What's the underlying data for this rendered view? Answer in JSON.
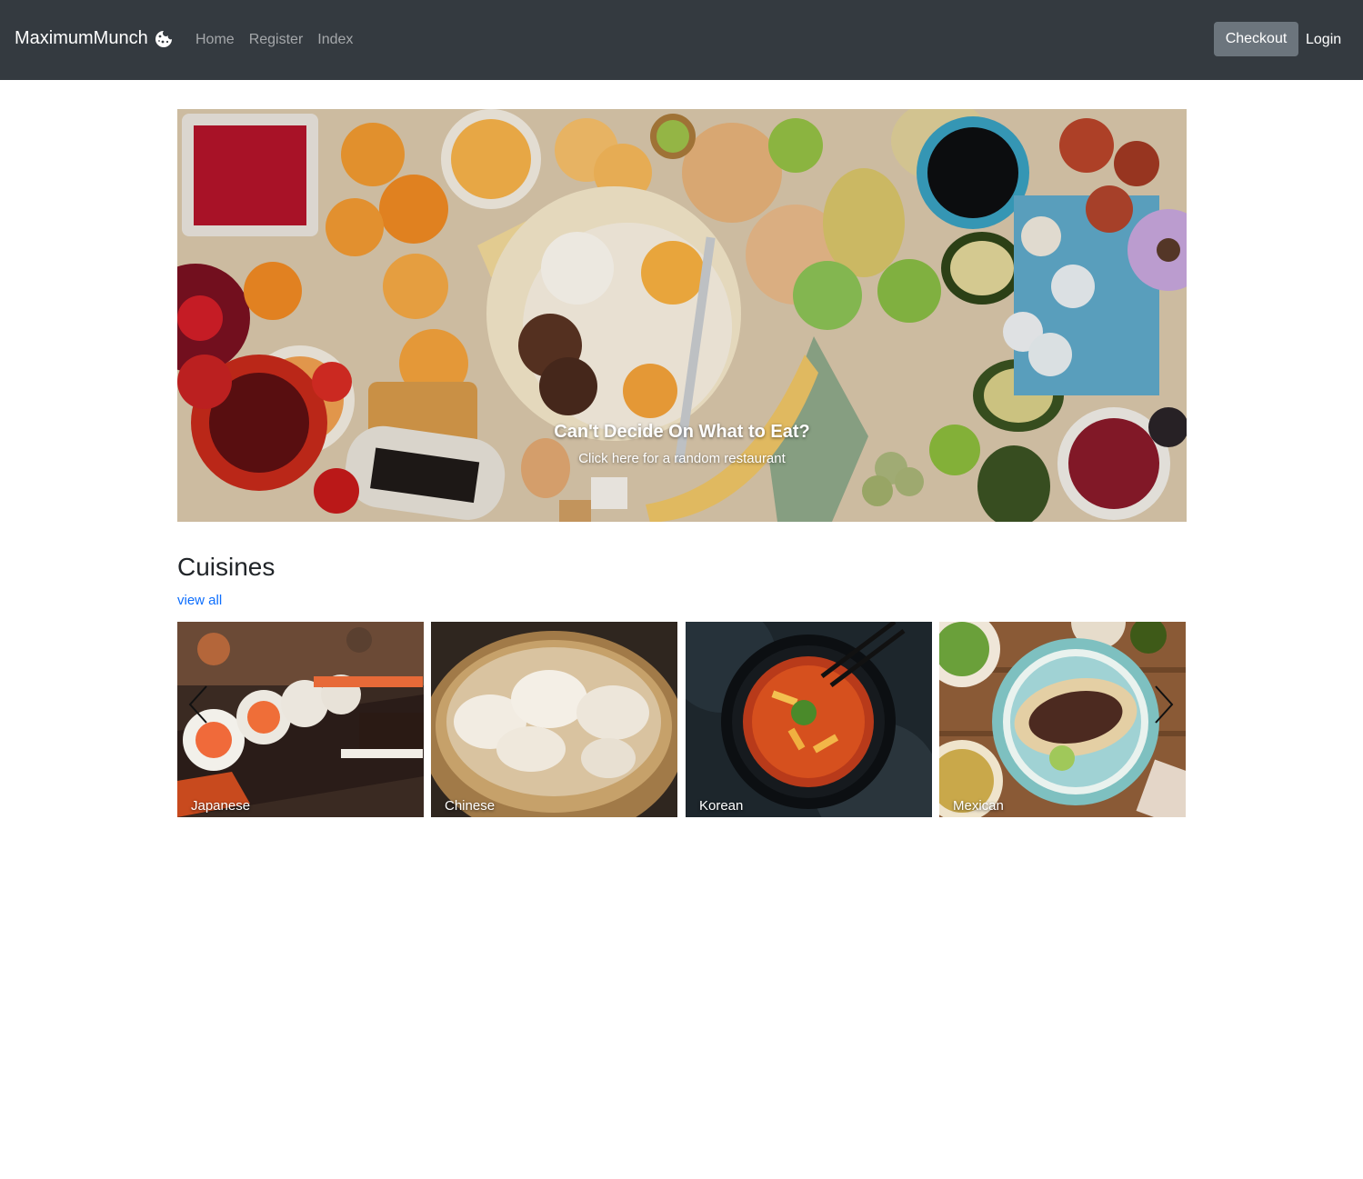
{
  "navbar": {
    "brand": "MaximumMunch",
    "brand_icon": "cookie-icon",
    "links": [
      {
        "label": "Home"
      },
      {
        "label": "Register"
      },
      {
        "label": "Index"
      }
    ],
    "checkout_label": "Checkout",
    "login_label": "Login",
    "colors": {
      "background": "#343a40",
      "link": "rgba(255,255,255,0.55)",
      "button": "#6c757d"
    }
  },
  "hero": {
    "title": "Can't Decide On What to Eat?",
    "subtitle": "Click here for a random restaurant"
  },
  "cuisines": {
    "heading": "Cuisines",
    "view_all": "view all",
    "items": [
      {
        "label": "Japanese"
      },
      {
        "label": "Chinese"
      },
      {
        "label": "Korean"
      },
      {
        "label": "Mexican"
      }
    ],
    "prev_icon": "chevron-left-icon",
    "next_icon": "chevron-right-icon"
  },
  "colors": {
    "accent": "#0d6efd",
    "text": "#212529"
  }
}
